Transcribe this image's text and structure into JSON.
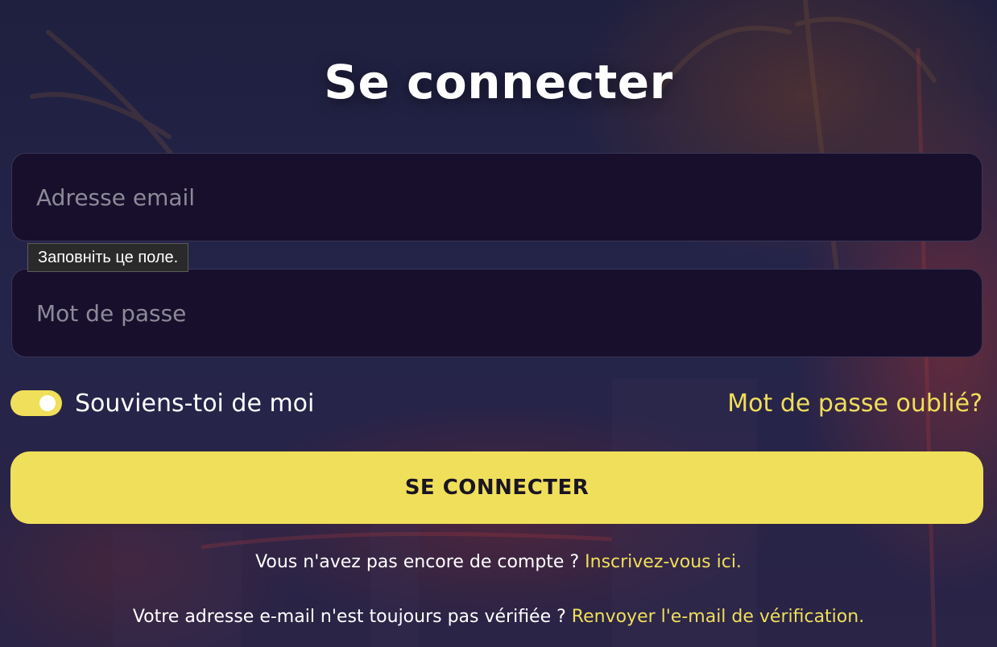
{
  "login": {
    "title": "Se connecter",
    "email_placeholder": "Adresse email",
    "password_placeholder": "Mot de passe",
    "validation_tooltip": "Заповніть це поле.",
    "remember_me_label": "Souviens-toi de moi",
    "remember_me_on": true,
    "forgot_password_link": "Mot de passe oublié?",
    "submit_label": "SE CONNECTER",
    "signup_prompt": "Vous n'avez pas encore de compte ?",
    "signup_link": "Inscrivez-vous ici.",
    "verify_prompt": "Votre adresse e-mail n'est toujours pas vérifiée ?",
    "verify_link": "Renvoyer l'e-mail de vérification."
  },
  "colors": {
    "accent": "#f0df5a",
    "field_background": "#170f2c",
    "page_background": "#232241"
  }
}
